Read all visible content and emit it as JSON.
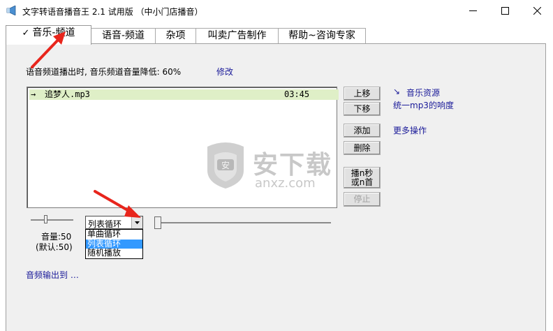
{
  "window": {
    "title": "文字转语音播音王 2.1 试用版 （中小门店播音）"
  },
  "tabs": [
    {
      "label": "音乐-频道",
      "check": "✓",
      "active": true
    },
    {
      "label": "语音-频道"
    },
    {
      "label": "杂项"
    },
    {
      "label": "叫卖广告制作"
    },
    {
      "label": "帮助~咨询专家"
    }
  ],
  "music_channel": {
    "duck_text": "语音频道播出时, 音乐频道音量降低: 60%",
    "modify_link": "修改",
    "playlist": [
      {
        "marker": "→",
        "name": "追梦人.mp3",
        "duration": "03:45"
      }
    ],
    "buttons": {
      "move_up": "上移",
      "move_down": "下移",
      "add": "添加",
      "delete": "删除",
      "play_n_line1": "播n秒",
      "play_n_line2": "或n首",
      "stop": "停止"
    },
    "side_links": {
      "music_resources_arrow": "↘",
      "music_resources": "音乐资源",
      "unify_mp3": "统一mp3的响度",
      "more_ops": "更多操作"
    },
    "volume": {
      "label": "音量:50",
      "default": "(默认:50)",
      "value": 50
    },
    "play_mode": {
      "selected": "列表循环",
      "options": [
        "单曲循环",
        "列表循环",
        "随机播放"
      ],
      "highlighted_index": 1
    },
    "audio_output": "音频输出到 …",
    "progress": 0
  },
  "watermark": {
    "text": "安下载",
    "sub": "anxz.com"
  },
  "colors": {
    "playing_row": "#dfefc7",
    "link": "#1a1a99",
    "selection": "#3399ff",
    "annotation_arrow": "#e8251c"
  }
}
